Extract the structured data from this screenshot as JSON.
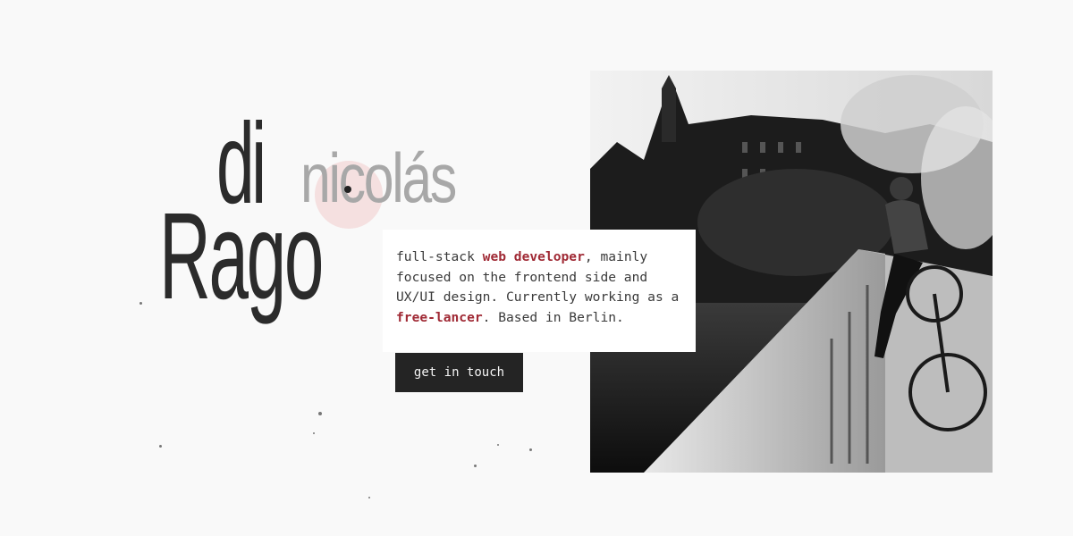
{
  "hero": {
    "first_name": "nicolás",
    "particle": "di",
    "last_name": "Rago",
    "intro": {
      "lead": "full-stack ",
      "highlight_role": "web developer",
      "middle": ", mainly focused on the frontend side and UX/UI design. Currently working as a ",
      "highlight_status": "free-lancer",
      "tail": ". Based in Berlin."
    },
    "cta_label": "get in touch"
  },
  "colors": {
    "background": "#f9f9f9",
    "text_dark": "#2b2b2b",
    "text_light": "#a8a8a8",
    "accent": "#a02a35",
    "button_bg": "#242424"
  },
  "photo": {
    "alt": "Black and white photo of a man sitting on a bridge railing with a bicycle in Berlin"
  }
}
